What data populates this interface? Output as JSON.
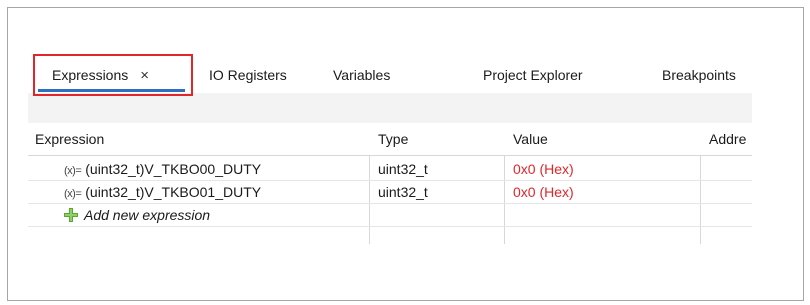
{
  "tabs": [
    {
      "label": "Expressions",
      "active": true,
      "close_glyph": "×"
    },
    {
      "label": "IO Registers"
    },
    {
      "label": "Variables"
    },
    {
      "label": "Project Explorer"
    },
    {
      "label": "Breakpoints"
    }
  ],
  "table": {
    "columns": [
      "Expression",
      "Type",
      "Value",
      "Addre"
    ],
    "rows": [
      {
        "icon": "(x)=",
        "expression": "(uint32_t)V_TKBO00_DUTY",
        "type": "uint32_t",
        "value": "0x0 (Hex)"
      },
      {
        "icon": "(x)=",
        "expression": "(uint32_t)V_TKBO01_DUTY",
        "type": "uint32_t",
        "value": "0x0 (Hex)"
      }
    ],
    "add_label": "Add new expression"
  },
  "colors": {
    "highlight": "#e0262b",
    "active_tab_underline": "#2f6ec2",
    "value_text": "#e0262b",
    "add_icon": "#5aa832"
  },
  "icons": {
    "variable": "variable-expression-icon",
    "add": "green-plus-icon",
    "close": "close-icon"
  }
}
